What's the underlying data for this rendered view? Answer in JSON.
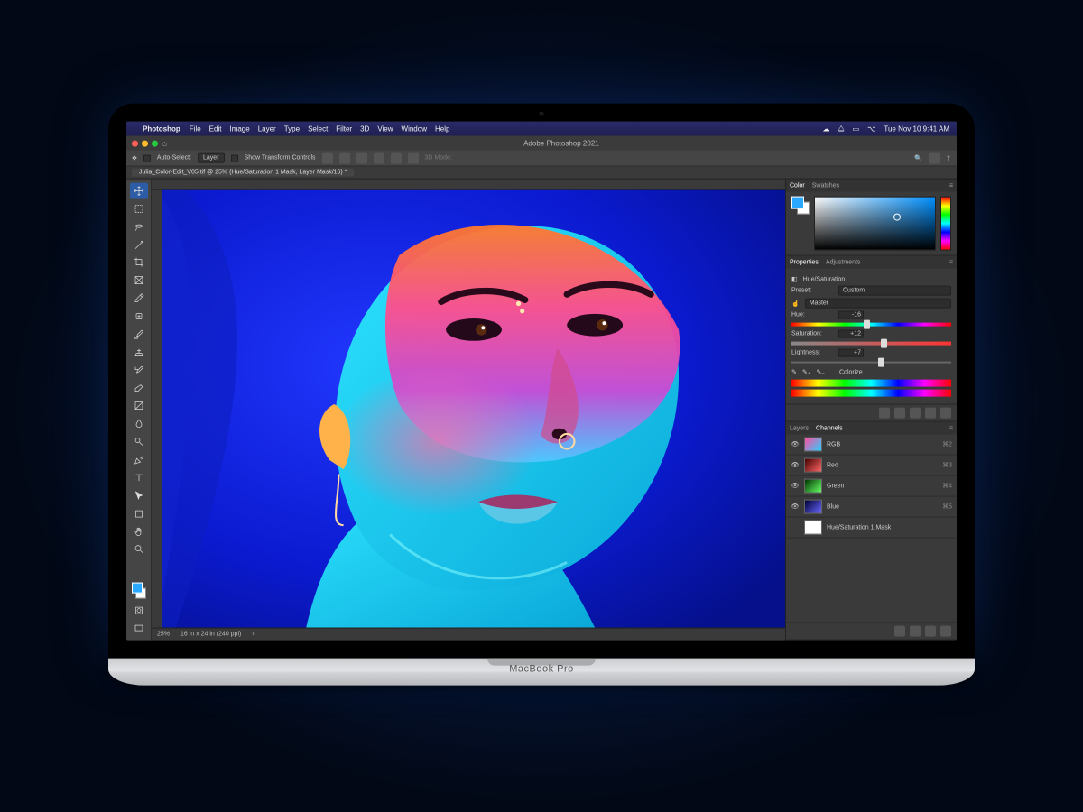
{
  "os_bar": {
    "app_name": "Photoshop",
    "menus": [
      "File",
      "Edit",
      "Image",
      "Layer",
      "Type",
      "Select",
      "Filter",
      "3D",
      "View",
      "Window",
      "Help"
    ],
    "datetime": "Tue Nov 10  9:41 AM"
  },
  "window": {
    "title": "Adobe Photoshop 2021"
  },
  "options_bar": {
    "auto_select_label": "Auto-Select:",
    "auto_select_value": "Layer",
    "show_transform_label": "Show Transform Controls",
    "mode_label": "3D Mode:"
  },
  "document": {
    "tab_title": "Julia_Color-Edit_V05.tif @ 25% (Hue/Saturation 1 Mask, Layer Mask/16) *",
    "zoom": "25%",
    "doc_info": "16 in x 24 in (240 ppi)"
  },
  "color_panel": {
    "tabs": [
      "Color",
      "Swatches"
    ]
  },
  "properties_panel": {
    "tabs": [
      "Properties",
      "Adjustments"
    ],
    "adj_type": "Hue/Saturation",
    "preset_label": "Preset:",
    "preset_value": "Custom",
    "range_value": "Master",
    "sliders": {
      "hue": {
        "label": "Hue:",
        "value": "-16",
        "pos": 45
      },
      "saturation": {
        "label": "Saturation:",
        "value": "+12",
        "pos": 56
      },
      "lightness": {
        "label": "Lightness:",
        "value": "+7",
        "pos": 54
      }
    },
    "colorize_label": "Colorize"
  },
  "channels_panel": {
    "tabs": [
      "Layers",
      "Channels"
    ],
    "items": [
      {
        "name": "RGB",
        "short": "⌘2",
        "cls": "rgb"
      },
      {
        "name": "Red",
        "short": "⌘3",
        "cls": "red"
      },
      {
        "name": "Green",
        "short": "⌘4",
        "cls": "green"
      },
      {
        "name": "Blue",
        "short": "⌘5",
        "cls": "blue"
      },
      {
        "name": "Hue/Saturation 1 Mask",
        "short": "",
        "cls": "mask"
      }
    ]
  },
  "hinge_label": "MacBook Pro"
}
